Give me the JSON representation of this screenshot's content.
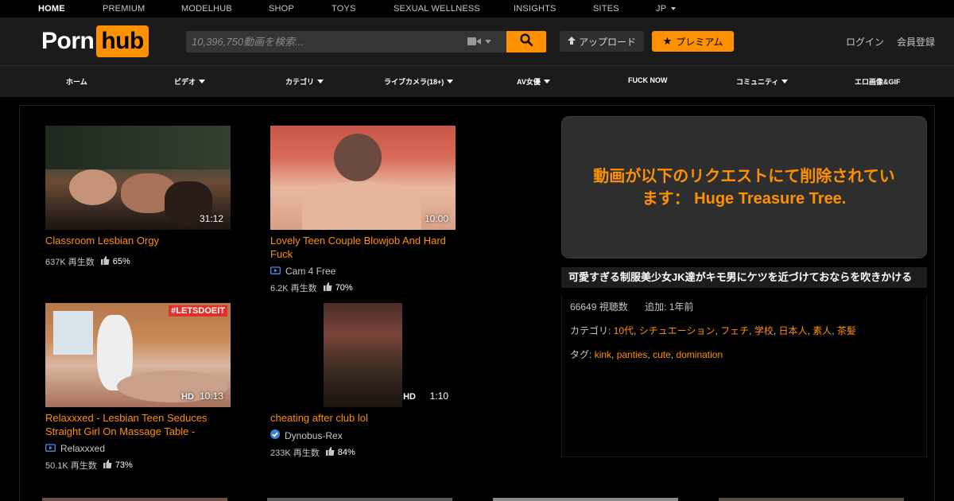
{
  "topbar": {
    "items": [
      "HOME",
      "PREMIUM",
      "MODELHUB",
      "SHOP",
      "TOYS",
      "SEXUAL WELLNESS",
      "INSIGHTS",
      "SITES",
      "JP"
    ]
  },
  "logo": {
    "part1": "Porn",
    "part2": "hub"
  },
  "search": {
    "placeholder": "10,396,750動画を検索..."
  },
  "buttons": {
    "upload": "アップロード",
    "premium": "プレミアム",
    "login": "ログイン",
    "signup": "会員登録"
  },
  "nav": {
    "items": [
      "ホーム",
      "ビデオ",
      "カテゴリ",
      "ライブカメラ(18+)",
      "AV女優",
      "FUCK NOW",
      "コミュニティ",
      "エロ画像&GIF"
    ]
  },
  "videos": [
    {
      "title": "Classroom Lesbian Orgy",
      "duration": "31:12",
      "hd": "",
      "channel": "",
      "views": "637K 再生数",
      "rating": "65%"
    },
    {
      "title": "Lovely Teen Couple Blowjob And Hard Fuck",
      "duration": "10:00",
      "hd": "",
      "channel": "Cam 4 Free",
      "views": "6.2K 再生数",
      "rating": "70%"
    },
    {
      "title": "Relaxxxed - Lesbian Teen Seduces Straight Girl On Massage Table -",
      "duration": "10:13",
      "hd": "HD",
      "channel": "Relaxxxed",
      "views": "50.1K 再生数",
      "rating": "73%",
      "badge": "#LETSDOEIT"
    },
    {
      "title": "cheating after club lol",
      "duration": "1:10",
      "hd": "HD",
      "channel": "Dynobus-Rex",
      "views": "233K 再生数",
      "rating": "84%"
    }
  ],
  "removed": {
    "message": "動画が以下のリクエストにて削除されています： Huge Treasure Tree."
  },
  "info": {
    "title": "可愛すぎる制服美少女JK達がキモ男にケツを近づけておならを吹きかける",
    "views": "66649 視聴数",
    "added": "追加: 1年前",
    "categories_label": "カテゴリ:",
    "categories": [
      "10代",
      "シチュエーション",
      "フェチ",
      "学校",
      "日本人",
      "素人",
      "茶髪"
    ],
    "tags_label": "タグ:",
    "tags": [
      "kink",
      "panties",
      "cute",
      "domination"
    ]
  },
  "colors": {
    "accent": "#ff9000",
    "header_bg": "#1b1b1b",
    "page_bg": "#000000"
  }
}
